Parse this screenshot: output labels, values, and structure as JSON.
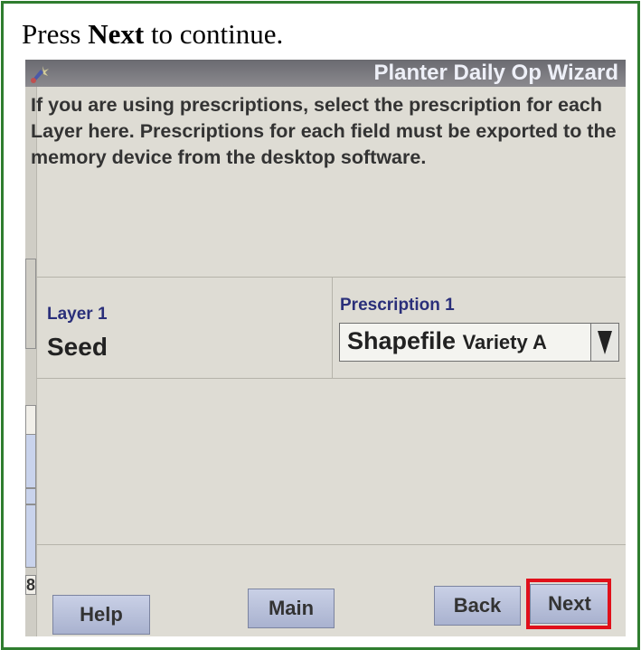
{
  "instruction": {
    "prefix": "Press ",
    "bold": "Next",
    "suffix": " to continue."
  },
  "wizard": {
    "title": "Planter Daily Op Wizard",
    "icon": "wizard-icon",
    "description": "If you are using prescriptions, select the prescription for each Layer here. Prescriptions for each field must be exported to the memory device from the desktop software."
  },
  "layer": {
    "label": "Layer 1",
    "value": "Seed"
  },
  "prescription": {
    "label": "Prescription 1",
    "value_main": "Shapefile",
    "value_suffix": "Variety A",
    "dropdown_icon": "chevron-down-icon"
  },
  "buttons": {
    "help": "Help",
    "main": "Main",
    "back": "Back",
    "next": "Next"
  },
  "side_strip": {
    "number": "8"
  },
  "colors": {
    "frame_border": "#2f7d2f",
    "highlight": "#e0101a",
    "label_text": "#2a2f7a",
    "button": "#b9c1dc"
  }
}
